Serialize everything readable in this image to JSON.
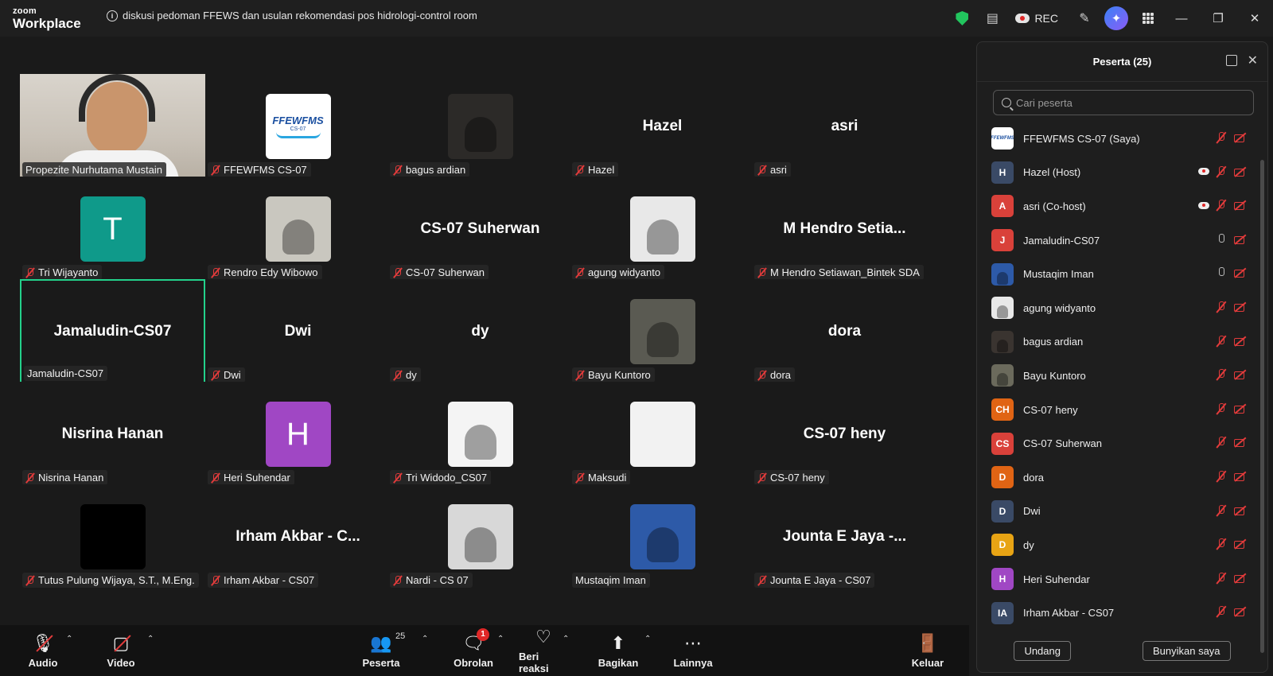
{
  "app": {
    "brand_top": "zoom",
    "brand_bottom": "Workplace",
    "meeting_title": "diskusi pedoman FFEWS dan usulan rekomendasi pos hidrologi-control room",
    "rec_label": "REC"
  },
  "colors": {
    "accent": "#0e72ed",
    "speaking_border": "#23d18b",
    "muted_red": "#e23b3b",
    "secure_green": "#22c55e"
  },
  "gallery": {
    "tiles": [
      {
        "label": "Propezite Nurhutama Mustain",
        "big": "",
        "type": "video",
        "muted": false
      },
      {
        "label": "FFEWFMS CS-07",
        "big": "",
        "type": "logo",
        "muted": true,
        "logo_text": "FFEWFMS",
        "logo_sub": "CS-07"
      },
      {
        "label": "bagus ardian",
        "big": "",
        "type": "photo",
        "muted": true,
        "bg": "#2c2a28"
      },
      {
        "label": "Hazel",
        "big": "Hazel",
        "type": "name",
        "muted": true
      },
      {
        "label": "asri",
        "big": "asri",
        "type": "name",
        "muted": true
      },
      {
        "label": "Tri Wijayanto",
        "big": "",
        "type": "initial",
        "initial": "T",
        "bg": "#0f9a8a",
        "muted": true
      },
      {
        "label": "Rendro Edy Wibowo",
        "big": "",
        "type": "photo",
        "muted": true,
        "bg": "#c9c7bf"
      },
      {
        "label": "CS-07 Suherwan",
        "big": "CS-07 Suherwan",
        "type": "name",
        "muted": true
      },
      {
        "label": "agung widyanto",
        "big": "",
        "type": "photo",
        "muted": true,
        "bg": "#e8e8e8"
      },
      {
        "label": "M Hendro Setiawan_Bintek SDA",
        "big": "M Hendro Setia...",
        "type": "name",
        "muted": true
      },
      {
        "label": "Jamaludin-CS07",
        "big": "Jamaludin-CS07",
        "type": "name",
        "muted": false,
        "speaking": true
      },
      {
        "label": "Dwi",
        "big": "Dwi",
        "type": "name",
        "muted": true
      },
      {
        "label": "dy",
        "big": "dy",
        "type": "name",
        "muted": true
      },
      {
        "label": "Bayu Kuntoro",
        "big": "",
        "type": "photo",
        "muted": true,
        "bg": "#5a5a52"
      },
      {
        "label": "dora",
        "big": "dora",
        "type": "name",
        "muted": true
      },
      {
        "label": "Nisrina Hanan",
        "big": "Nisrina Hanan",
        "type": "name",
        "muted": true
      },
      {
        "label": "Heri Suhendar",
        "big": "",
        "type": "initial",
        "initial": "H",
        "bg": "#a047c4",
        "muted": true
      },
      {
        "label": "Tri Widodo_CS07",
        "big": "",
        "type": "photo",
        "muted": true,
        "bg": "#f4f4f4"
      },
      {
        "label": "Maksudi",
        "big": "",
        "type": "photo",
        "muted": true,
        "bg": "#f2f2f2"
      },
      {
        "label": "CS-07 heny",
        "big": "CS-07 heny",
        "type": "name",
        "muted": true
      },
      {
        "label": "Tutus Pulung Wijaya, S.T., M.Eng.",
        "big": "",
        "type": "photo",
        "muted": true,
        "bg": "#000000"
      },
      {
        "label": "Irham Akbar - CS07",
        "big": "Irham Akbar - C...",
        "type": "name",
        "muted": true
      },
      {
        "label": "Nardi - CS 07",
        "big": "",
        "type": "photo",
        "muted": true,
        "bg": "#d8d8d8"
      },
      {
        "label": "Mustaqim Iman",
        "big": "",
        "type": "photo",
        "muted": false,
        "bg": "#2d5aa8"
      },
      {
        "label": "Jounta E Jaya - CS07",
        "big": "Jounta E Jaya -...",
        "type": "name",
        "muted": true
      }
    ]
  },
  "toolbar": {
    "audio": "Audio",
    "video": "Video",
    "participants": "Peserta",
    "participants_count": "25",
    "chat": "Obrolan",
    "chat_badge": "1",
    "react": "Beri reaksi",
    "share": "Bagikan",
    "more": "Lainnya",
    "leave": "Keluar"
  },
  "panel": {
    "title": "Peserta (25)",
    "search_placeholder": "Cari peserta",
    "invite": "Undang",
    "unmute": "Bunyikan saya",
    "participants": [
      {
        "name": "FFEWFMS CS-07 (Saya)",
        "avatar": "",
        "bg": "#ffffff",
        "logo": true,
        "mic": "muted",
        "rec": false
      },
      {
        "name": "Hazel (Host)",
        "avatar": "H",
        "bg": "#3a4a66",
        "mic": "muted",
        "rec": true
      },
      {
        "name": "asri (Co-host)",
        "avatar": "A",
        "bg": "#d9413a",
        "mic": "muted",
        "rec": true
      },
      {
        "name": "Jamaludin-CS07",
        "avatar": "J",
        "bg": "#d9413a",
        "mic": "on",
        "rec": false
      },
      {
        "name": "Mustaqim Iman",
        "avatar": "",
        "bg": "#2d5aa8",
        "mic": "on",
        "rec": false
      },
      {
        "name": "agung widyanto",
        "avatar": "",
        "bg": "#e8e8e8",
        "mic": "muted",
        "rec": false
      },
      {
        "name": "bagus ardian",
        "avatar": "",
        "bg": "#3a3430",
        "mic": "muted",
        "rec": false
      },
      {
        "name": "Bayu Kuntoro",
        "avatar": "",
        "bg": "#6b6a5c",
        "mic": "muted",
        "rec": false
      },
      {
        "name": "CS-07 heny",
        "avatar": "CH",
        "bg": "#e06414",
        "mic": "muted",
        "rec": false
      },
      {
        "name": "CS-07 Suherwan",
        "avatar": "CS",
        "bg": "#d9413a",
        "mic": "muted",
        "rec": false
      },
      {
        "name": "dora",
        "avatar": "D",
        "bg": "#e06414",
        "mic": "muted",
        "rec": false
      },
      {
        "name": "Dwi",
        "avatar": "D",
        "bg": "#3a4a66",
        "mic": "muted",
        "rec": false
      },
      {
        "name": "dy",
        "avatar": "D",
        "bg": "#e8a414",
        "mic": "muted",
        "rec": false
      },
      {
        "name": "Heri Suhendar",
        "avatar": "H",
        "bg": "#a047c4",
        "mic": "muted",
        "rec": false
      },
      {
        "name": "Irham Akbar - CS07",
        "avatar": "IA",
        "bg": "#3a4a66",
        "mic": "muted",
        "rec": false
      }
    ]
  }
}
